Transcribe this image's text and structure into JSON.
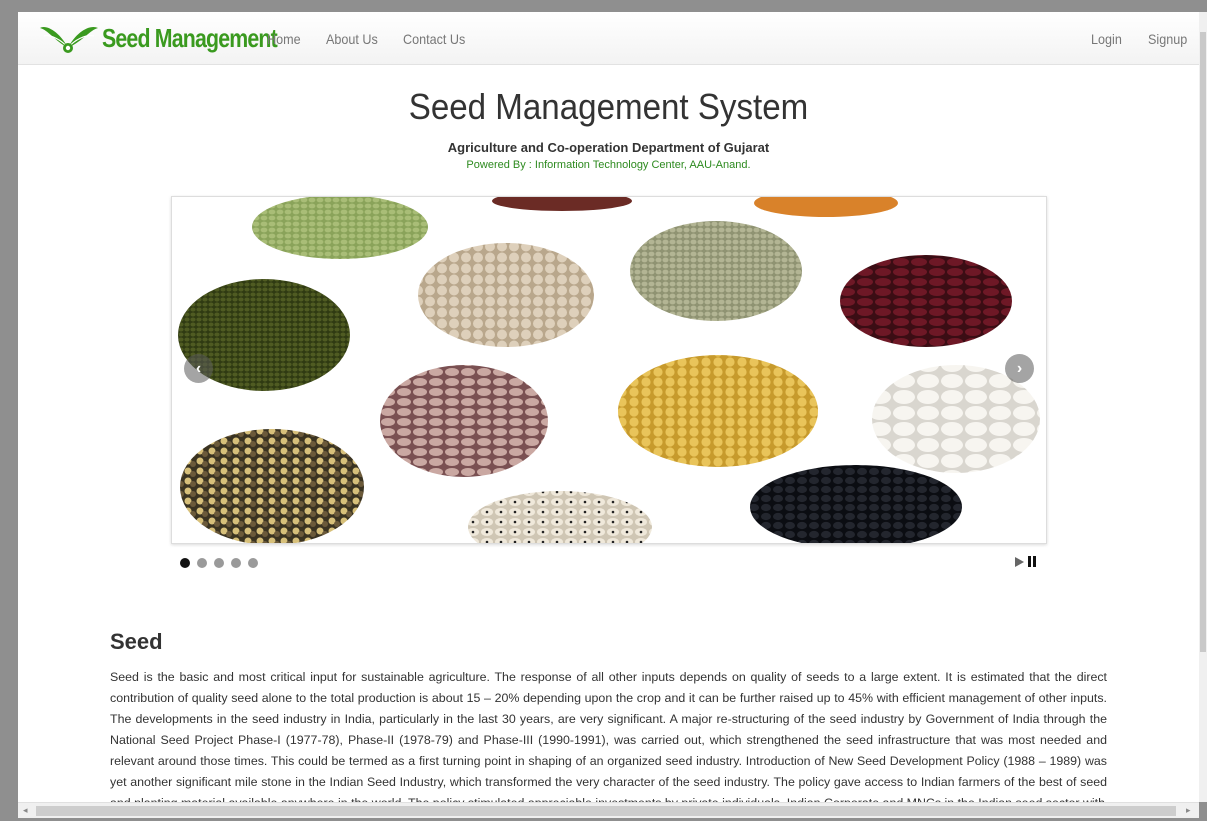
{
  "brand": {
    "name": "Seed Management",
    "color": "#3a9a1f"
  },
  "nav": {
    "left": [
      {
        "label": "Home"
      },
      {
        "label": "About Us"
      },
      {
        "label": "Contact Us"
      }
    ],
    "right": [
      {
        "label": "Login"
      },
      {
        "label": "Signup"
      }
    ]
  },
  "header": {
    "title": "Seed Management System",
    "subtitle": "Agriculture and Co-operation Department of Gujarat",
    "powered_by": "Powered By : Information Technology Center, AAU-Anand."
  },
  "carousel": {
    "prev_icon": "chevron-left-icon",
    "next_icon": "chevron-right-icon",
    "slide_count": 5,
    "active_slide": 1,
    "controls": {
      "play_icon": "play-icon",
      "pause_icon": "pause-icon"
    }
  },
  "section": {
    "title": "Seed",
    "body": "Seed is the basic and most critical input for sustainable agriculture. The response of all other inputs depends on quality of seeds to a large extent. It is estimated that the direct contribution of quality seed alone to the total production is about 15 – 20% depending upon the crop and it can be further raised up to 45% with efficient management of other inputs. The developments in the seed industry in India, particularly in the last 30 years, are very significant. A major re-structuring of the seed industry by Government of India through the National Seed Project Phase-I (1977-78), Phase-II (1978-79) and Phase-III (1990-1991), was carried out, which strengthened the seed infrastructure that was most needed and relevant around those times. This could be termed as a first turning point in shaping of an organized seed industry. Introduction of New Seed Development Policy (1988 – 1989) was yet another significant mile stone in the Indian Seed Industry, which transformed the very character of the seed industry. The policy gave access to Indian farmers of the best of seed and planting material available anywhere in the world. The policy stimulated appreciable investments by private individuals, Indian Corporate and MNCs in the Indian seed sector with"
  }
}
